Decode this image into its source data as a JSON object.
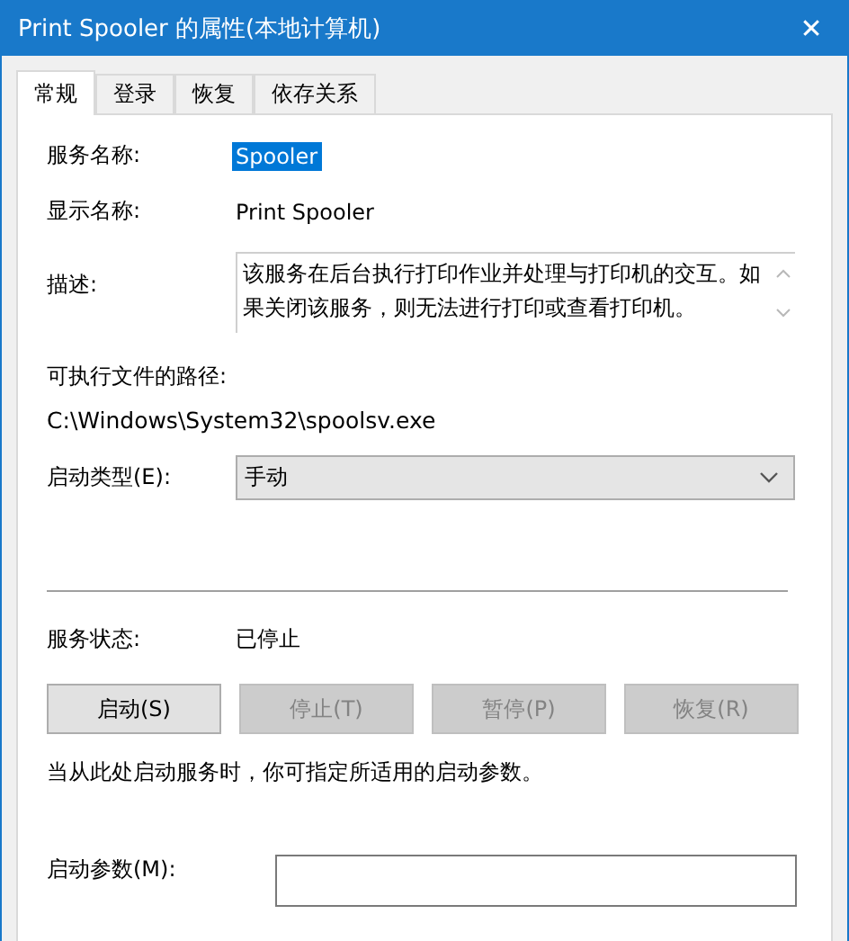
{
  "window": {
    "title": "Print Spooler 的属性(本地计算机)",
    "close": "✕"
  },
  "tabs": [
    {
      "label": "常规",
      "selected": true
    },
    {
      "label": "登录",
      "selected": false
    },
    {
      "label": "恢复",
      "selected": false
    },
    {
      "label": "依存关系",
      "selected": false
    }
  ],
  "service_name": {
    "label": "服务名称:",
    "value": "Spooler",
    "selected": true
  },
  "display_name": {
    "label": "显示名称:",
    "value": "Print Spooler"
  },
  "description": {
    "label": "描述:",
    "value": "该服务在后台执行打印作业并处理与打印机的交互。如果关闭该服务，则无法进行打印或查看打印机。"
  },
  "executable_path": {
    "label": "可执行文件的路径:",
    "value": "C:\\Windows\\System32\\spoolsv.exe"
  },
  "startup_type": {
    "label": "启动类型(E):",
    "value": "手动"
  },
  "service_status": {
    "label": "服务状态:",
    "value": "已停止"
  },
  "buttons": [
    {
      "label": "启动(S)",
      "disabled": false
    },
    {
      "label": "停止(T)",
      "disabled": true
    },
    {
      "label": "暂停(P)",
      "disabled": true
    },
    {
      "label": "恢复(R)",
      "disabled": true
    }
  ],
  "hint": "当从此处启动服务时，你可指定所适用的启动参数。",
  "start_parameters": {
    "label": "启动参数(M):"
  }
}
